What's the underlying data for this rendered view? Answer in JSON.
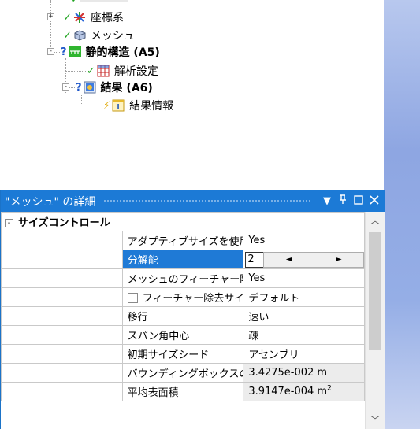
{
  "tree": {
    "items": [
      {
        "label": "座標系",
        "bold": false
      },
      {
        "label": "メッシュ",
        "bold": false
      },
      {
        "label": "静的構造 (A5)",
        "bold": true
      },
      {
        "label": "解析設定",
        "bold": false
      },
      {
        "label": "結果 (A6)",
        "bold": true
      },
      {
        "label": "結果情報",
        "bold": false
      }
    ]
  },
  "details": {
    "title": "\"メッシュ\" の詳細",
    "header_icons": [
      "chevron-down-icon",
      "pin-icon",
      "maximize-icon",
      "close-icon"
    ],
    "category": {
      "label": "サイズコントロール",
      "expander": "-"
    },
    "rows": [
      {
        "name": "アダプティブサイズを使用",
        "value": "Yes"
      },
      {
        "name": "分解能",
        "value": "2"
      },
      {
        "name": "メッシュのフィーチャー除去",
        "value": "Yes"
      },
      {
        "name": "フィーチャー除去サイズ",
        "value": "デフォルト"
      },
      {
        "name": "移行",
        "value": "速い"
      },
      {
        "name": "スパン角中心",
        "value": "疎"
      },
      {
        "name": "初期サイズシード",
        "value": "アセンブリ"
      },
      {
        "name": "バウンディングボックスの対角...",
        "value": "3.4275e-002 m"
      },
      {
        "name": "平均表面積",
        "value": "3.9147e-004 m",
        "unit_sup": "2"
      }
    ],
    "spinner": {
      "left_arrow": "◄",
      "right_arrow": "►"
    }
  },
  "colors": {
    "header_bg": "#1c7ad6",
    "selection": "#1f7ad6",
    "check": "#1fa31f",
    "readonly_bg": "#ececec"
  }
}
